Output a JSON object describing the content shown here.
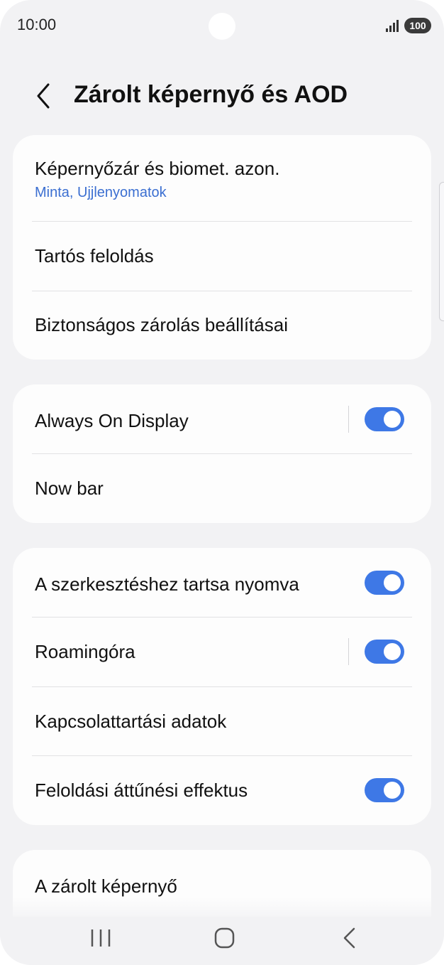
{
  "status_bar": {
    "time": "10:00",
    "battery": "100"
  },
  "header": {
    "title": "Zárolt képernyő és AOD"
  },
  "groups": [
    {
      "items": [
        {
          "title": "Képernyőzár és biomet. azon.",
          "subtitle": "Minta, Ujjlenyomatok"
        },
        {
          "title": "Tartós feloldás"
        },
        {
          "title": "Biztonságos zárolás beállításai"
        }
      ]
    },
    {
      "items": [
        {
          "title": "Always On Display",
          "toggle": true
        },
        {
          "title": "Now bar"
        }
      ]
    },
    {
      "items": [
        {
          "title": "A szerkesztéshez tartsa nyomva",
          "toggle": true
        },
        {
          "title": "Roamingóra",
          "toggle": true
        },
        {
          "title": "Kapcsolattartási adatok"
        },
        {
          "title": "Feloldási áttűnési effektus",
          "toggle": true
        }
      ]
    },
    {
      "items": [
        {
          "title": "A zárolt képernyő"
        }
      ]
    }
  ],
  "colors": {
    "accent": "#3e78e6",
    "subtitle": "#3b6fd1",
    "background": "#f2f2f4",
    "card": "#fdfdfd"
  },
  "icons": {
    "back": "chevron-left-icon",
    "signal": "signal-icon",
    "battery": "battery-icon",
    "nav_recents": "recents-icon",
    "nav_home": "home-icon",
    "nav_back": "back-icon"
  }
}
